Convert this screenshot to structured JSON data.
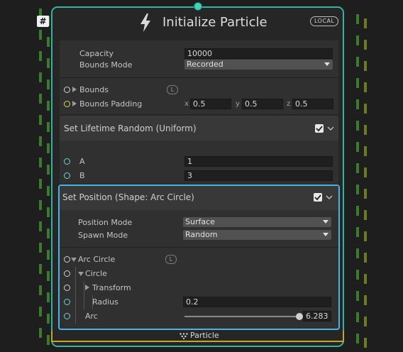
{
  "hashtag": "#",
  "node": {
    "title": "Initialize Particle",
    "badge": "LOCAL"
  },
  "init": {
    "capacity_label": "Capacity",
    "capacity_value": "10000",
    "bounds_mode_label": "Bounds Mode",
    "bounds_mode_value": "Recorded",
    "bounds_label": "Bounds",
    "bounds_badge": "L",
    "bounds_padding_label": "Bounds Padding",
    "x_label": "x",
    "x_value": "0.5",
    "y_label": "y",
    "y_value": "0.5",
    "z_label": "z",
    "z_value": "0.5"
  },
  "lifetime": {
    "title": "Set Lifetime Random (Uniform)",
    "enabled": true,
    "a_label": "A",
    "a_value": "1",
    "b_label": "B",
    "b_value": "3"
  },
  "position": {
    "title": "Set Position (Shape: Arc Circle)",
    "enabled": true,
    "mode_label": "Position Mode",
    "mode_value": "Surface",
    "spawn_label": "Spawn Mode",
    "spawn_value": "Random",
    "arc_circle_label": "Arc Circle",
    "arc_circle_badge": "L",
    "circle_label": "Circle",
    "transform_label": "Transform",
    "radius_label": "Radius",
    "radius_value": "0.2",
    "arc_label": "Arc",
    "arc_value": "6.283",
    "arc_fraction": 1.0
  },
  "footer": {
    "label": "Particle"
  },
  "colors": {
    "node_border": "#35b3a0",
    "selected_border": "#4ab3e6",
    "footer_border": "#c6a52a"
  },
  "icons": [
    "bolt-icon",
    "checkmark-icon",
    "chevron-down-icon",
    "particle-dots-icon"
  ]
}
